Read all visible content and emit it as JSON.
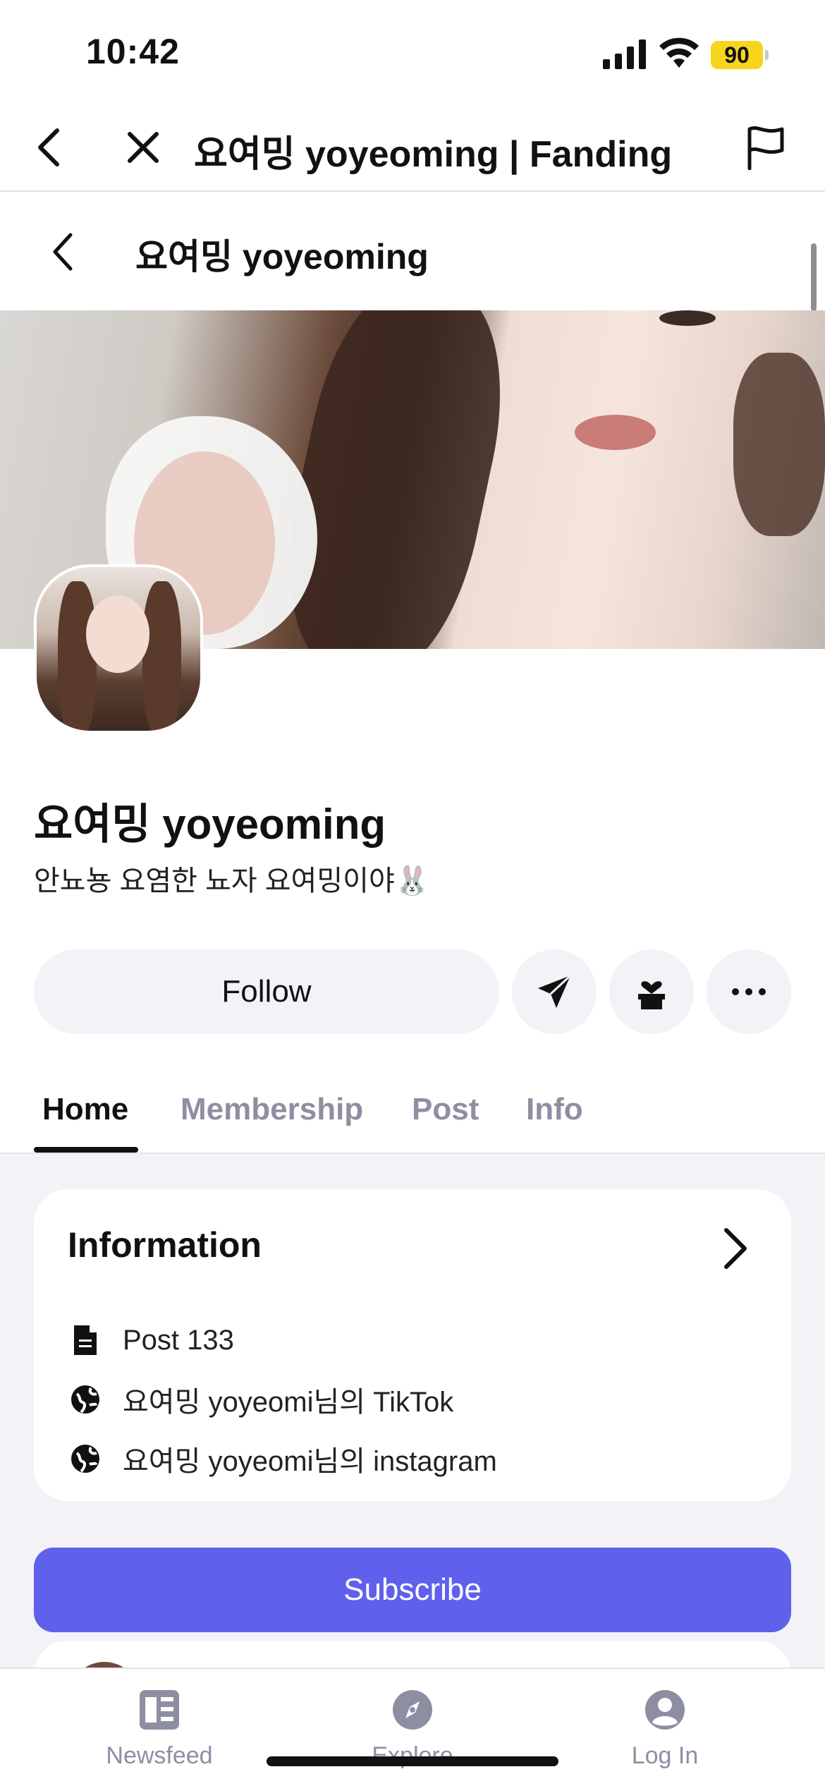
{
  "status_bar": {
    "time": "10:42",
    "battery": "90"
  },
  "browser": {
    "title": "요여밍 yoyeoming | Fanding"
  },
  "page_header": {
    "title": "요여밍 yoyeoming"
  },
  "profile": {
    "name": "요여밍 yoyeoming",
    "bio": "안뇨뇽 요염한 뇨자 요여밍이야🐰"
  },
  "actions": {
    "follow_label": "Follow"
  },
  "tabs": [
    {
      "label": "Home",
      "active": true
    },
    {
      "label": "Membership",
      "active": false
    },
    {
      "label": "Post",
      "active": false
    },
    {
      "label": "Info",
      "active": false
    }
  ],
  "information": {
    "title": "Information",
    "rows": [
      {
        "icon": "document-icon",
        "text": "Post 133"
      },
      {
        "icon": "globe-icon",
        "text": "요여밍 yoyeomi님의 TikTok"
      },
      {
        "icon": "globe-icon",
        "text": "요여밍 yoyeomi님의 instagram"
      }
    ]
  },
  "subscribe_label": "Subscribe",
  "bottom_nav": [
    {
      "label": "Newsfeed",
      "icon": "newsfeed-icon"
    },
    {
      "label": "Explore",
      "icon": "explore-icon"
    },
    {
      "label": "Log In",
      "icon": "user-icon"
    }
  ],
  "colors": {
    "accent": "#5f60eb",
    "battery": "#f7d51d",
    "muted": "#8e8ea3",
    "surface": "#f2f2f7"
  }
}
